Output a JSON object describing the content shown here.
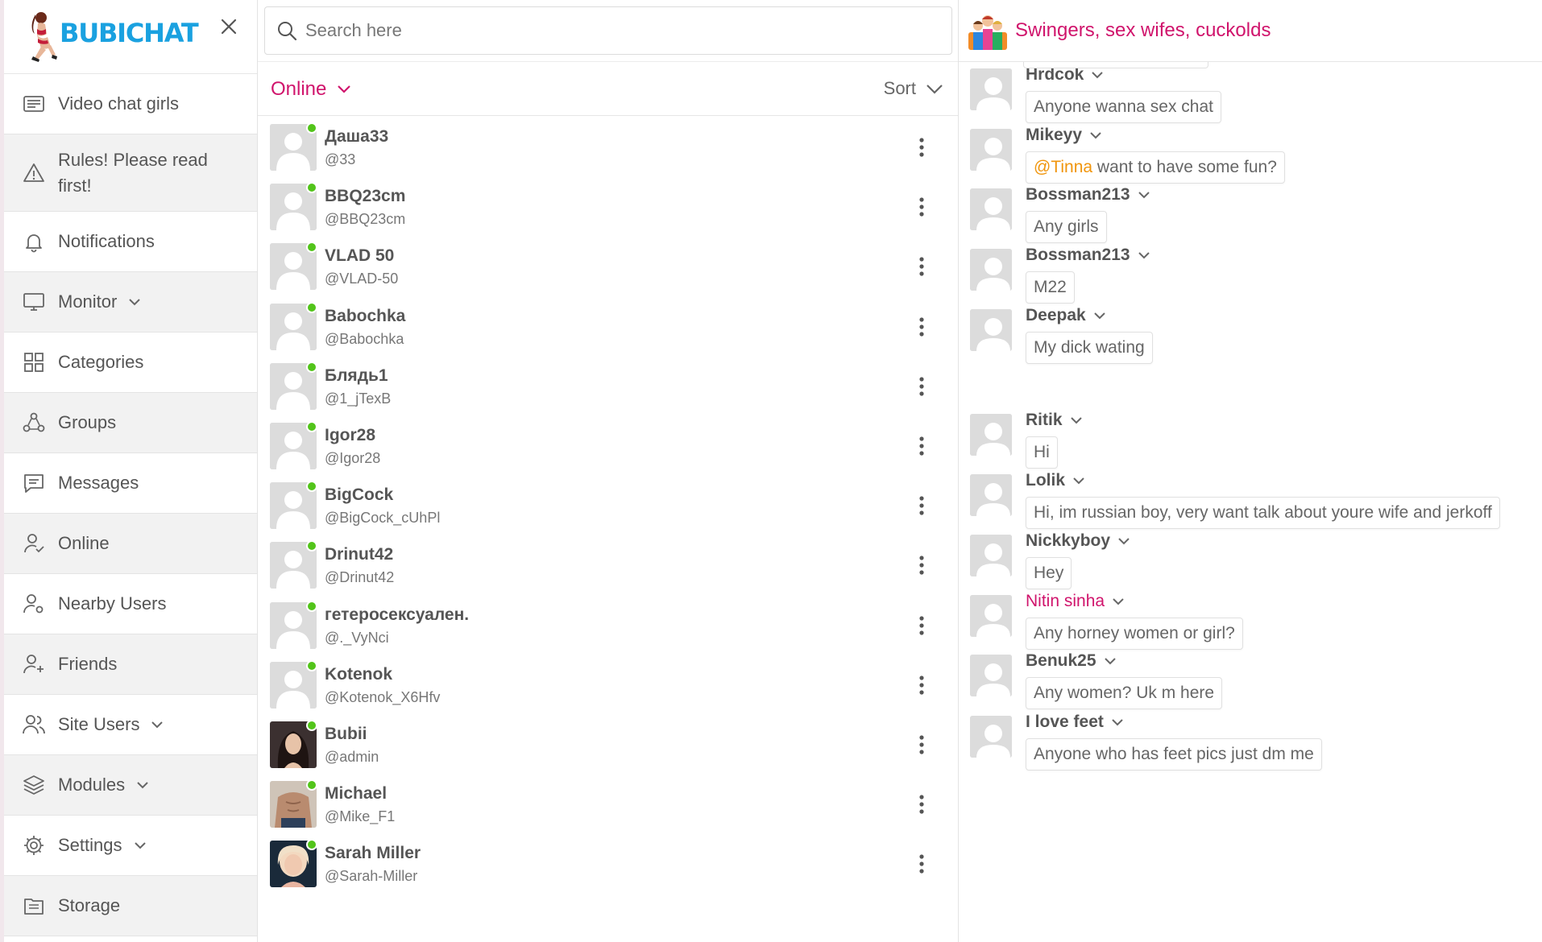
{
  "brand": {
    "logo_text": "BUBICHAT",
    "colors": {
      "accent": "#d0146c",
      "logo_blue": "#1aa1e0",
      "online_green": "#52c41a",
      "mention": "#f0950c"
    }
  },
  "sidebar": {
    "items": [
      {
        "label": "Video chat girls",
        "icon": "news-icon",
        "has_chevron": false
      },
      {
        "label": "Rules! Please read first!",
        "icon": "warning-icon",
        "has_chevron": false
      },
      {
        "label": "Notifications",
        "icon": "bell-icon",
        "has_chevron": false
      },
      {
        "label": "Monitor",
        "icon": "monitor-icon",
        "has_chevron": true
      },
      {
        "label": "Categories",
        "icon": "grid-icon",
        "has_chevron": false
      },
      {
        "label": "Groups",
        "icon": "groups-icon",
        "has_chevron": false
      },
      {
        "label": "Messages",
        "icon": "message-icon",
        "has_chevron": false
      },
      {
        "label": "Online",
        "icon": "user-check-icon",
        "has_chevron": false
      },
      {
        "label": "Nearby Users",
        "icon": "user-location-icon",
        "has_chevron": false
      },
      {
        "label": "Friends",
        "icon": "user-plus-icon",
        "has_chevron": false
      },
      {
        "label": "Site Users",
        "icon": "users-icon",
        "has_chevron": true
      },
      {
        "label": "Modules",
        "icon": "layers-icon",
        "has_chevron": true
      },
      {
        "label": "Settings",
        "icon": "gear-icon",
        "has_chevron": true
      },
      {
        "label": "Storage",
        "icon": "storage-icon",
        "has_chevron": false
      }
    ]
  },
  "search": {
    "placeholder": "Search here"
  },
  "filter": {
    "label": "Online",
    "sort_label": "Sort"
  },
  "users": [
    {
      "name": "Даша33",
      "handle": "@33",
      "avatar": "default"
    },
    {
      "name": "BBQ23cm",
      "handle": "@BBQ23cm",
      "avatar": "default"
    },
    {
      "name": "VLAD 50",
      "handle": "@VLAD-50",
      "avatar": "default"
    },
    {
      "name": "Babochka",
      "handle": "@Babochka",
      "avatar": "default"
    },
    {
      "name": "Блядь1",
      "handle": "@1_jTexB",
      "avatar": "default"
    },
    {
      "name": "Igor28",
      "handle": "@Igor28",
      "avatar": "default"
    },
    {
      "name": "BigCock",
      "handle": "@BigCock_cUhPl",
      "avatar": "default"
    },
    {
      "name": "Drinut42",
      "handle": "@Drinut42",
      "avatar": "default"
    },
    {
      "name": "гетеросексуален.",
      "handle": "@._VyNci",
      "avatar": "default"
    },
    {
      "name": "Kotenok",
      "handle": "@Kotenok_X6Hfv",
      "avatar": "default"
    },
    {
      "name": "Bubii",
      "handle": "@admin",
      "avatar": "photo-dark-hair"
    },
    {
      "name": "Michael",
      "handle": "@Mike_F1",
      "avatar": "photo-torso"
    },
    {
      "name": "Sarah Miller",
      "handle": "@Sarah-Miller",
      "avatar": "photo-blonde"
    }
  ],
  "chat": {
    "title": "Swingers, sex wifes, cuckolds",
    "messages": [
      {
        "author": "Hrdcok",
        "text": "Anyone wanna sex chat",
        "highlight": false
      },
      {
        "author": "Mikeyy",
        "mention": "@Tinna",
        "text": " want to have some fun?",
        "highlight": false
      },
      {
        "author": "Bossman213",
        "text": "Any girls",
        "highlight": false
      },
      {
        "author": "Bossman213",
        "text": "M22",
        "highlight": false
      },
      {
        "author": "Deepak",
        "text": "My dick wating",
        "highlight": false
      },
      {
        "author": "Ritik",
        "text": "Hi",
        "highlight": false
      },
      {
        "author": "Lolik",
        "text": "Hi, im russian boy, very want talk about youre wife and jerkoff",
        "highlight": false
      },
      {
        "author": "Nickkyboy",
        "text": "Hey",
        "highlight": false
      },
      {
        "author": "Nitin sinha",
        "text": "Any horney women or girl?",
        "highlight": true
      },
      {
        "author": "Benuk25",
        "text": "Any women? Uk m here",
        "highlight": false
      },
      {
        "author": "I love feet",
        "text": "Anyone who has feet pics just dm me",
        "highlight": false
      }
    ]
  }
}
